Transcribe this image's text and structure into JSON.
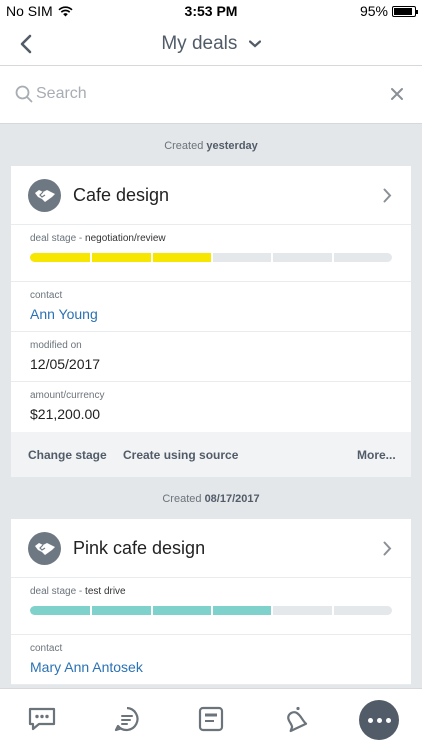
{
  "status_bar": {
    "carrier": "No SIM",
    "time": "3:53 PM",
    "battery": "95%",
    "battery_level": 0.95
  },
  "nav": {
    "title": "My deals"
  },
  "search": {
    "placeholder": "Search"
  },
  "accent": {
    "yellow": "#f7e600",
    "teal": "#7fd1cb",
    "link": "#2a72b5"
  },
  "groups": [
    {
      "date_prefix": "Created",
      "date_value": "yesterday",
      "deal": {
        "title": "Cafe design",
        "stage_label": "deal stage - ",
        "stage_value": "negotiation/review",
        "stage_progress": 0.5,
        "contact_label": "contact",
        "contact_value": "Ann Young",
        "modified_label": "modified on",
        "modified_value": "12/05/2017",
        "amount_label": "amount/currency",
        "amount_value": "$21,200.00"
      },
      "actions": {
        "change_stage": "Change stage",
        "create_source": "Create using source",
        "more": "More..."
      }
    },
    {
      "date_prefix": "Created",
      "date_value": "08/17/2017",
      "deal": {
        "title": "Pink cafe design",
        "stage_label": "deal stage - ",
        "stage_value": "test drive",
        "stage_progress": 0.667,
        "contact_label": "contact",
        "contact_value": "Mary Ann Antosek"
      }
    }
  ],
  "tabs": [
    "chat-icon",
    "activity-stream-icon",
    "tasks-icon",
    "notifications-icon",
    "more-icon"
  ]
}
